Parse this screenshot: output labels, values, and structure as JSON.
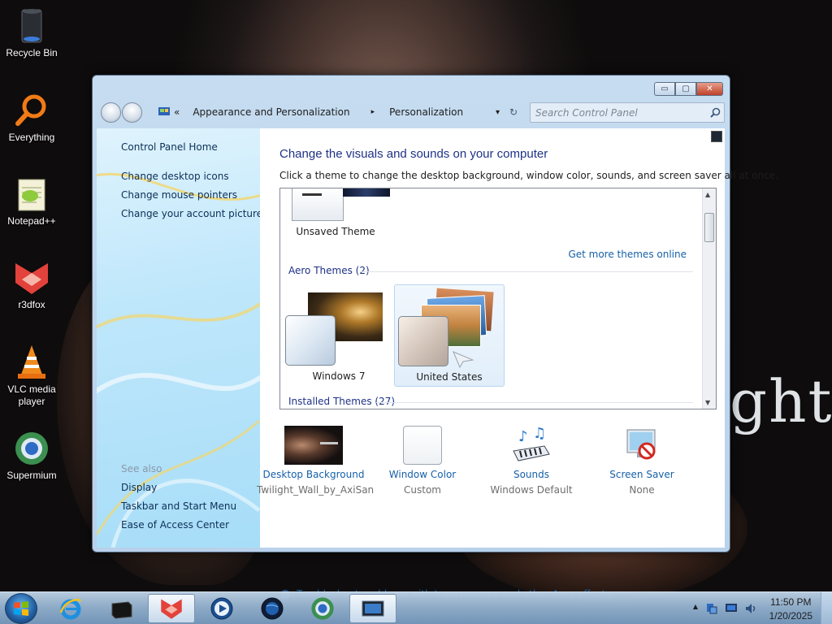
{
  "desktop": {
    "icons": [
      {
        "label": "Recycle Bin",
        "icon": "recycle-bin-icon"
      },
      {
        "label": "Everything",
        "icon": "magnifier-icon"
      },
      {
        "label": "Notepad++",
        "icon": "notepad-icon"
      },
      {
        "label": "r3dfox",
        "icon": "r3dfox-icon"
      },
      {
        "label": "VLC media player",
        "icon": "vlc-cone-icon"
      },
      {
        "label": "Supermium",
        "icon": "supermium-icon"
      }
    ],
    "wallpaper_text": "ght"
  },
  "window": {
    "caption_buttons": {
      "minimize": "▭",
      "maximize": "▢",
      "close": "✕"
    },
    "address": {
      "overflow": "«",
      "crumb1": "Appearance and Personalization",
      "crumb2": "Personalization",
      "separator": "▸",
      "dropdown": "▾",
      "refresh": "↻"
    },
    "search": {
      "placeholder": "Search Control Panel"
    },
    "sidebar": {
      "home": "Control Panel Home",
      "links": [
        "Change desktop icons",
        "Change mouse pointers",
        "Change your account picture"
      ],
      "see_also_label": "See also",
      "see_also": [
        "Display",
        "Taskbar and Start Menu",
        "Ease of Access Center"
      ]
    },
    "main": {
      "title": "Change the visuals and sounds on your computer",
      "description": "Click a theme to change the desktop background, window color, sounds, and screen saver all at once.",
      "themes": {
        "unsaved_theme_name": "Unsaved Theme",
        "get_more_link": "Get more themes online",
        "aero_group_label": "Aero Themes (2)",
        "aero_themes": [
          {
            "name": "Windows 7",
            "selected": false
          },
          {
            "name": "United States",
            "selected": true
          }
        ],
        "installed_group_label": "Installed Themes (27)"
      },
      "bottom": [
        {
          "label": "Desktop Background",
          "value": "Twilight_Wall_by_AxiSan",
          "icon": "desktop-background-thumb"
        },
        {
          "label": "Window Color",
          "value": "Custom",
          "icon": "window-color-swatch"
        },
        {
          "label": "Sounds",
          "value": "Windows Default",
          "icon": "music-keyboard-icon"
        },
        {
          "label": "Screen Saver",
          "value": "None",
          "icon": "no-screensaver-icon"
        }
      ],
      "troubleshoot_link": "Troubleshoot problems with transparency and other Aero effects"
    }
  },
  "taskbar": {
    "buttons": [
      {
        "name": "internet-explorer",
        "active": false
      },
      {
        "name": "terminal",
        "active": false
      },
      {
        "name": "r3dfox",
        "active": true
      },
      {
        "name": "media-player",
        "active": false
      },
      {
        "name": "globe-browser",
        "active": false
      },
      {
        "name": "supermium",
        "active": false
      },
      {
        "name": "control-panel",
        "active": true
      }
    ],
    "tray": {
      "overflow_arrow": "▲"
    },
    "clock": {
      "time": "11:50 PM",
      "date": "1/20/2025"
    }
  },
  "colors": {
    "link_blue": "#1660a8",
    "title_blue": "#1e3287",
    "close_red": "#c0412a",
    "sidebar_cyan": "#a7ddf8"
  }
}
